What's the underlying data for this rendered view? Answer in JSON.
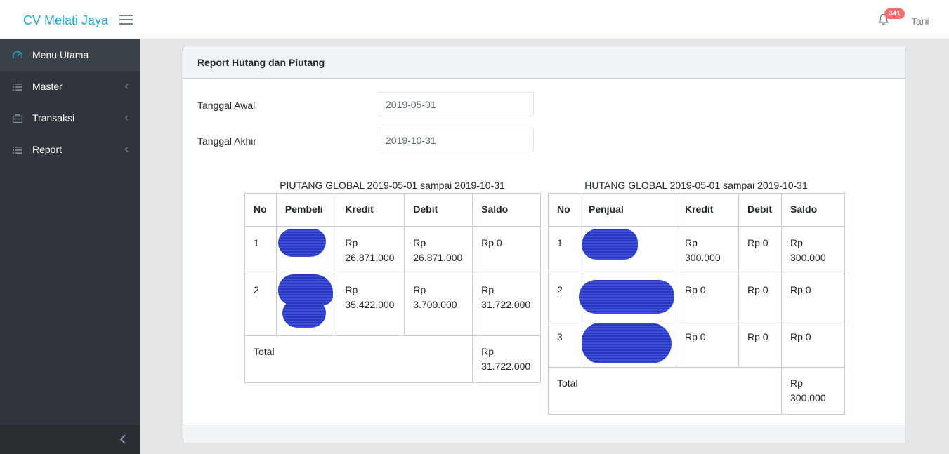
{
  "header": {
    "brand": "CV Melati Jaya",
    "notification_count": "341",
    "username": "Tarii"
  },
  "sidebar": {
    "items": [
      {
        "label": "Menu Utama",
        "icon": "speedometer-icon"
      },
      {
        "label": "Master",
        "icon": "list-icon"
      },
      {
        "label": "Transaksi",
        "icon": "briefcase-icon"
      },
      {
        "label": "Report",
        "icon": "list-icon"
      }
    ]
  },
  "card": {
    "title": "Report Hutang dan Piutang",
    "tanggal_awal_label": "Tanggal Awal",
    "tanggal_awal_value": "2019-05-01",
    "tanggal_akhir_label": "Tanggal Akhir",
    "tanggal_akhir_value": "2019-10-31"
  },
  "piutang": {
    "caption": "PIUTANG GLOBAL 2019-05-01 sampai 2019-10-31",
    "headers": [
      "No",
      "Pembeli",
      "Kredit",
      "Debit",
      "Saldo"
    ],
    "rows": [
      {
        "no": "1",
        "kredit_1": "Rp",
        "kredit_2": "26.871.000",
        "debit_1": "Rp",
        "debit_2": "26.871.000",
        "saldo_1": "Rp 0",
        "saldo_2": ""
      },
      {
        "no": "2",
        "kredit_1": "Rp",
        "kredit_2": "35.422.000",
        "debit_1": "Rp",
        "debit_2": "3.700.000",
        "saldo_1": "Rp",
        "saldo_2": "31.722.000"
      }
    ],
    "total_label": "Total",
    "total_1": "Rp",
    "total_2": "31.722.000"
  },
  "hutang": {
    "caption": "HUTANG GLOBAL 2019-05-01 sampai 2019-10-31",
    "headers": [
      "No",
      "Penjual",
      "Kredit",
      "Debit",
      "Saldo"
    ],
    "rows": [
      {
        "no": "1",
        "kredit_1": "Rp",
        "kredit_2": "300.000",
        "debit": "Rp 0",
        "saldo_1": "Rp",
        "saldo_2": "300.000"
      },
      {
        "no": "2",
        "kredit_1": "Rp 0",
        "kredit_2": "",
        "debit": "Rp 0",
        "saldo_1": "Rp 0",
        "saldo_2": ""
      },
      {
        "no": "3",
        "kredit_1": "Rp 0",
        "kredit_2": "",
        "debit": "Rp 0",
        "saldo_1": "Rp 0",
        "saldo_2": ""
      }
    ],
    "total_label": "Total",
    "total_1": "Rp",
    "total_2": "300.000"
  },
  "colors": {
    "brand": "#20a8d8",
    "sidebar": "#2f353a",
    "badge": "#f86c6b",
    "redaction": "#3c4fd6"
  }
}
